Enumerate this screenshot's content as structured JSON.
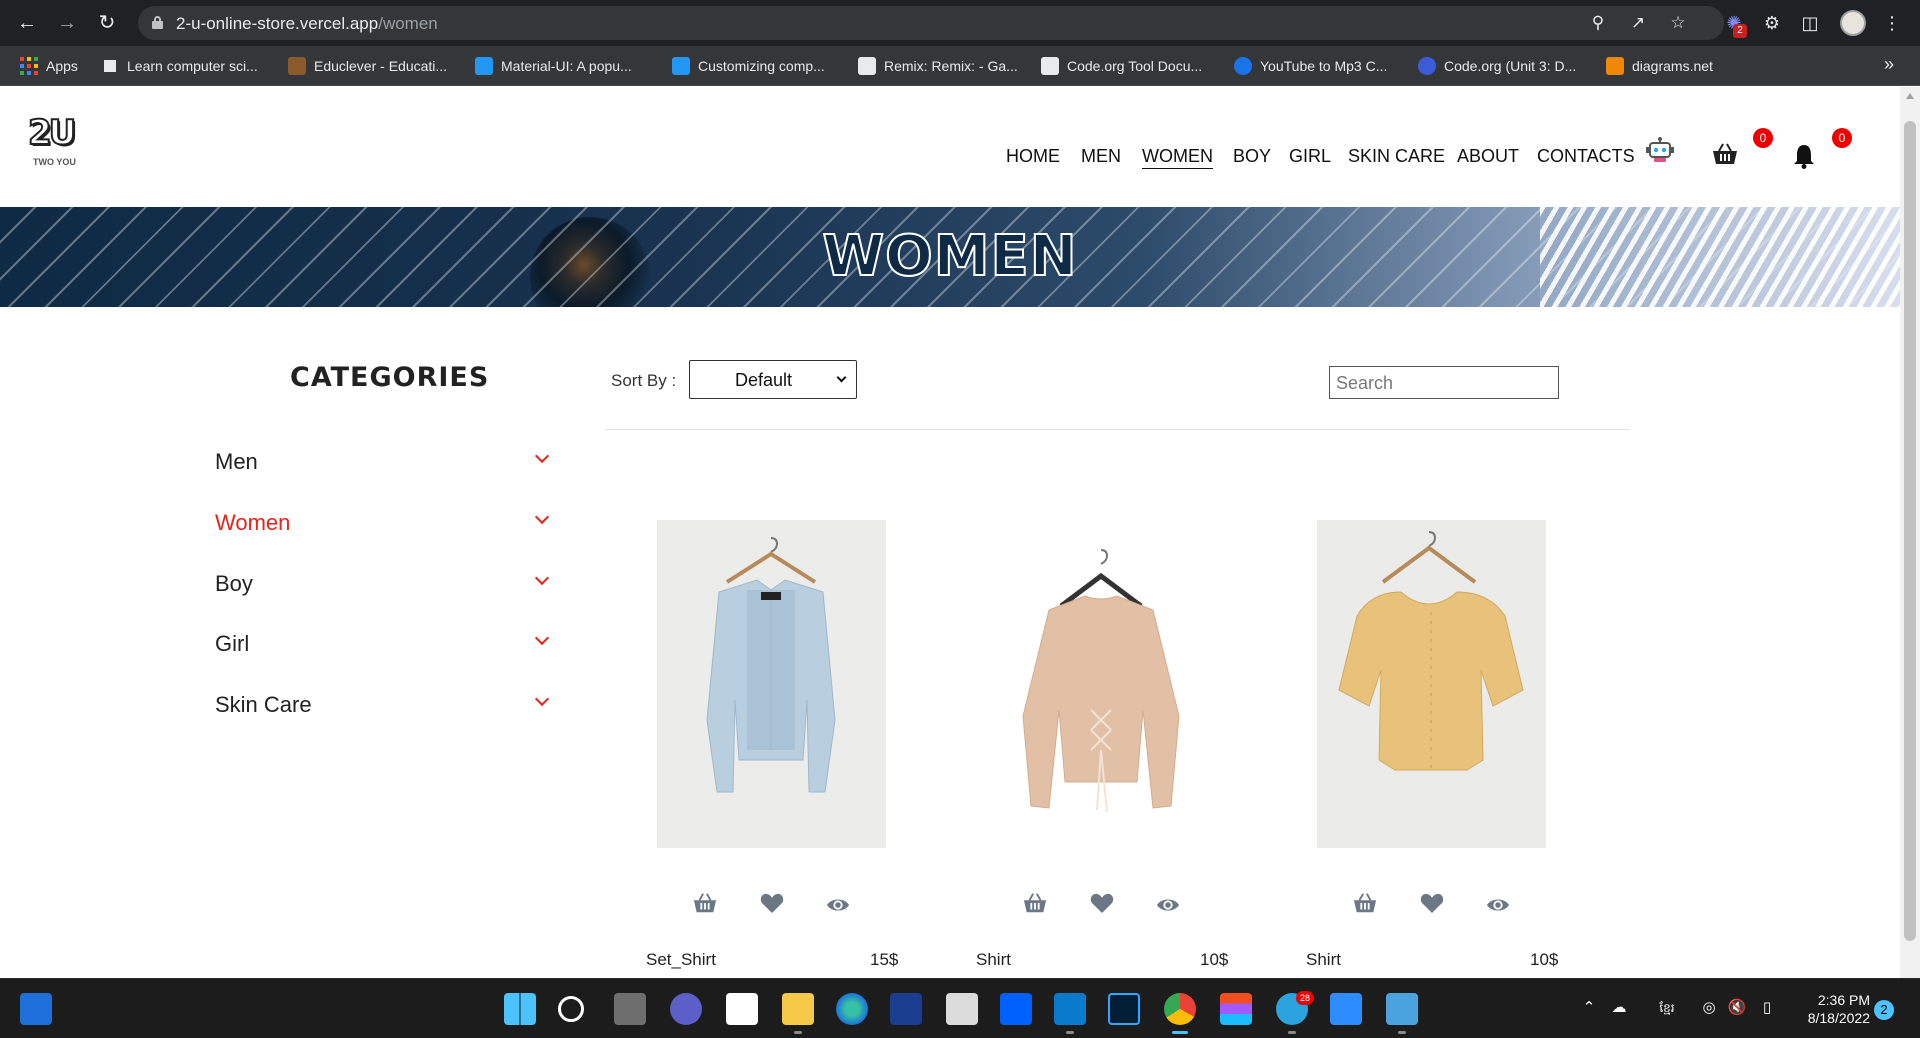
{
  "browser": {
    "url_host": "2-u-online-store.vercel.app",
    "url_path": "/women",
    "extension_badge": "2",
    "bookmarks": [
      {
        "label": "Apps"
      },
      {
        "label": "Learn computer sci..."
      },
      {
        "label": "Educlever - Educati..."
      },
      {
        "label": "Material-UI: A popu..."
      },
      {
        "label": "Customizing comp..."
      },
      {
        "label": "Remix: Remix: - Ga..."
      },
      {
        "label": "Code.org Tool Docu..."
      },
      {
        "label": "YouTube to Mp3 C..."
      },
      {
        "label": "Code.org (Unit 3: D..."
      },
      {
        "label": "diagrams.net"
      }
    ],
    "bookmarks_overflow": "»"
  },
  "site": {
    "logo_text": "2U",
    "logo_subtitle": "TWO YOU",
    "nav": [
      {
        "label": "HOME"
      },
      {
        "label": "MEN"
      },
      {
        "label": "WOMEN"
      },
      {
        "label": "BOY"
      },
      {
        "label": "GIRL"
      },
      {
        "label": "SKIN CARE"
      },
      {
        "label": "ABOUT"
      },
      {
        "label": "CONTACTS"
      }
    ],
    "cart_count": "0",
    "notification_count": "0"
  },
  "banner": {
    "title": "WOMEN"
  },
  "sidebar": {
    "title": "CATEGORIES",
    "items": [
      {
        "label": "Men"
      },
      {
        "label": "Women"
      },
      {
        "label": "Boy"
      },
      {
        "label": "Girl"
      },
      {
        "label": "Skin Care"
      }
    ],
    "active": "Women"
  },
  "toolbar": {
    "sort_label": "Sort By :",
    "sort_value": "Default",
    "search_placeholder": "Search"
  },
  "products": [
    {
      "name": "Set_Shirt",
      "price": "15$",
      "color": "#b9cfe0"
    },
    {
      "name": "Shirt",
      "price": "10$",
      "color": "#e2c0a6"
    },
    {
      "name": "Shirt",
      "price": "10$",
      "color": "#e8c27a"
    }
  ],
  "taskbar": {
    "time": "2:36 PM",
    "date": "8/18/2022",
    "notifications": "2",
    "telegram_badge": "28",
    "language": "ខ្មែរ"
  },
  "colors": {
    "accent_red": "#e8231a",
    "icon_gray": "#6b7785",
    "chrome_bg": "#202124"
  }
}
